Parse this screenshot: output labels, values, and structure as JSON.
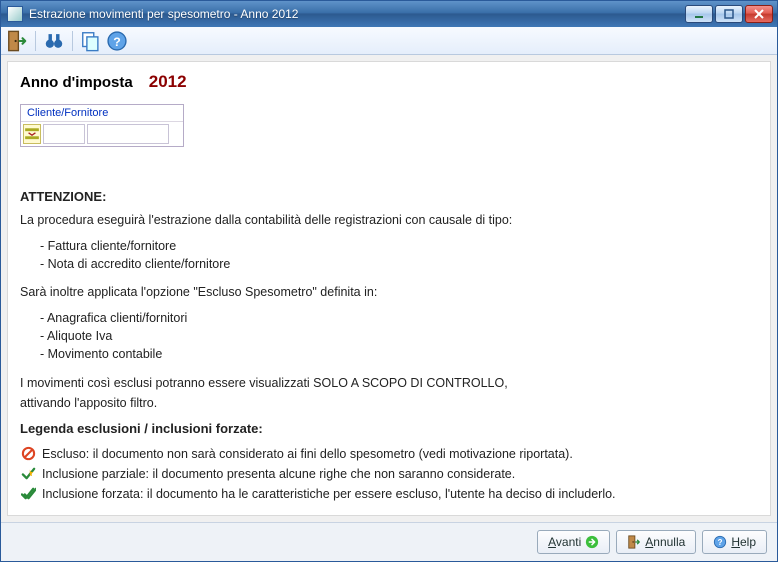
{
  "window": {
    "title": "Estrazione movimenti per spesometro - Anno 2012"
  },
  "toolbar": {
    "exit_tip": "Esci",
    "find_tip": "Cerca",
    "copy_tip": "Copia",
    "help_tip": "Aiuto"
  },
  "main": {
    "anno_label": "Anno d'imposta",
    "anno_value": "2012",
    "cf_header": "Cliente/Fornitore",
    "cf_code_placeholder": "",
    "cf_name_placeholder": ""
  },
  "info": {
    "heading": "ATTENZIONE:",
    "intro": "La procedura eseguirà l'estrazione dalla contabilità delle registrazioni con causale di tipo:",
    "bul1": "Fattura cliente/fornitore",
    "bul2": "Nota di accredito cliente/fornitore",
    "applied": "Sarà inoltre applicata l'opzione \"Escluso Spesometro\" definita in:",
    "ap1": "Anagrafica clienti/fornitori",
    "ap2": "Aliquote Iva",
    "ap3": "Movimento contabile",
    "mov1": "I movimenti così esclusi potranno essere visualizzati SOLO A SCOPO DI CONTROLLO,",
    "mov2": "attivando l'apposito filtro.",
    "legend_title": "Legenda esclusioni / inclusioni forzate:",
    "excl": "Escluso: il documento non sarà considerato ai fini dello spesometro (vedi motivazione riportata).",
    "parz": "Inclusione parziale: il documento presenta alcune righe che non saranno considerate.",
    "forz": "Inclusione forzata: il documento ha le caratteristiche per essere escluso, l'utente ha deciso di includerlo."
  },
  "footer": {
    "next": "Avanti",
    "cancel": "Annulla",
    "help": "Help"
  }
}
